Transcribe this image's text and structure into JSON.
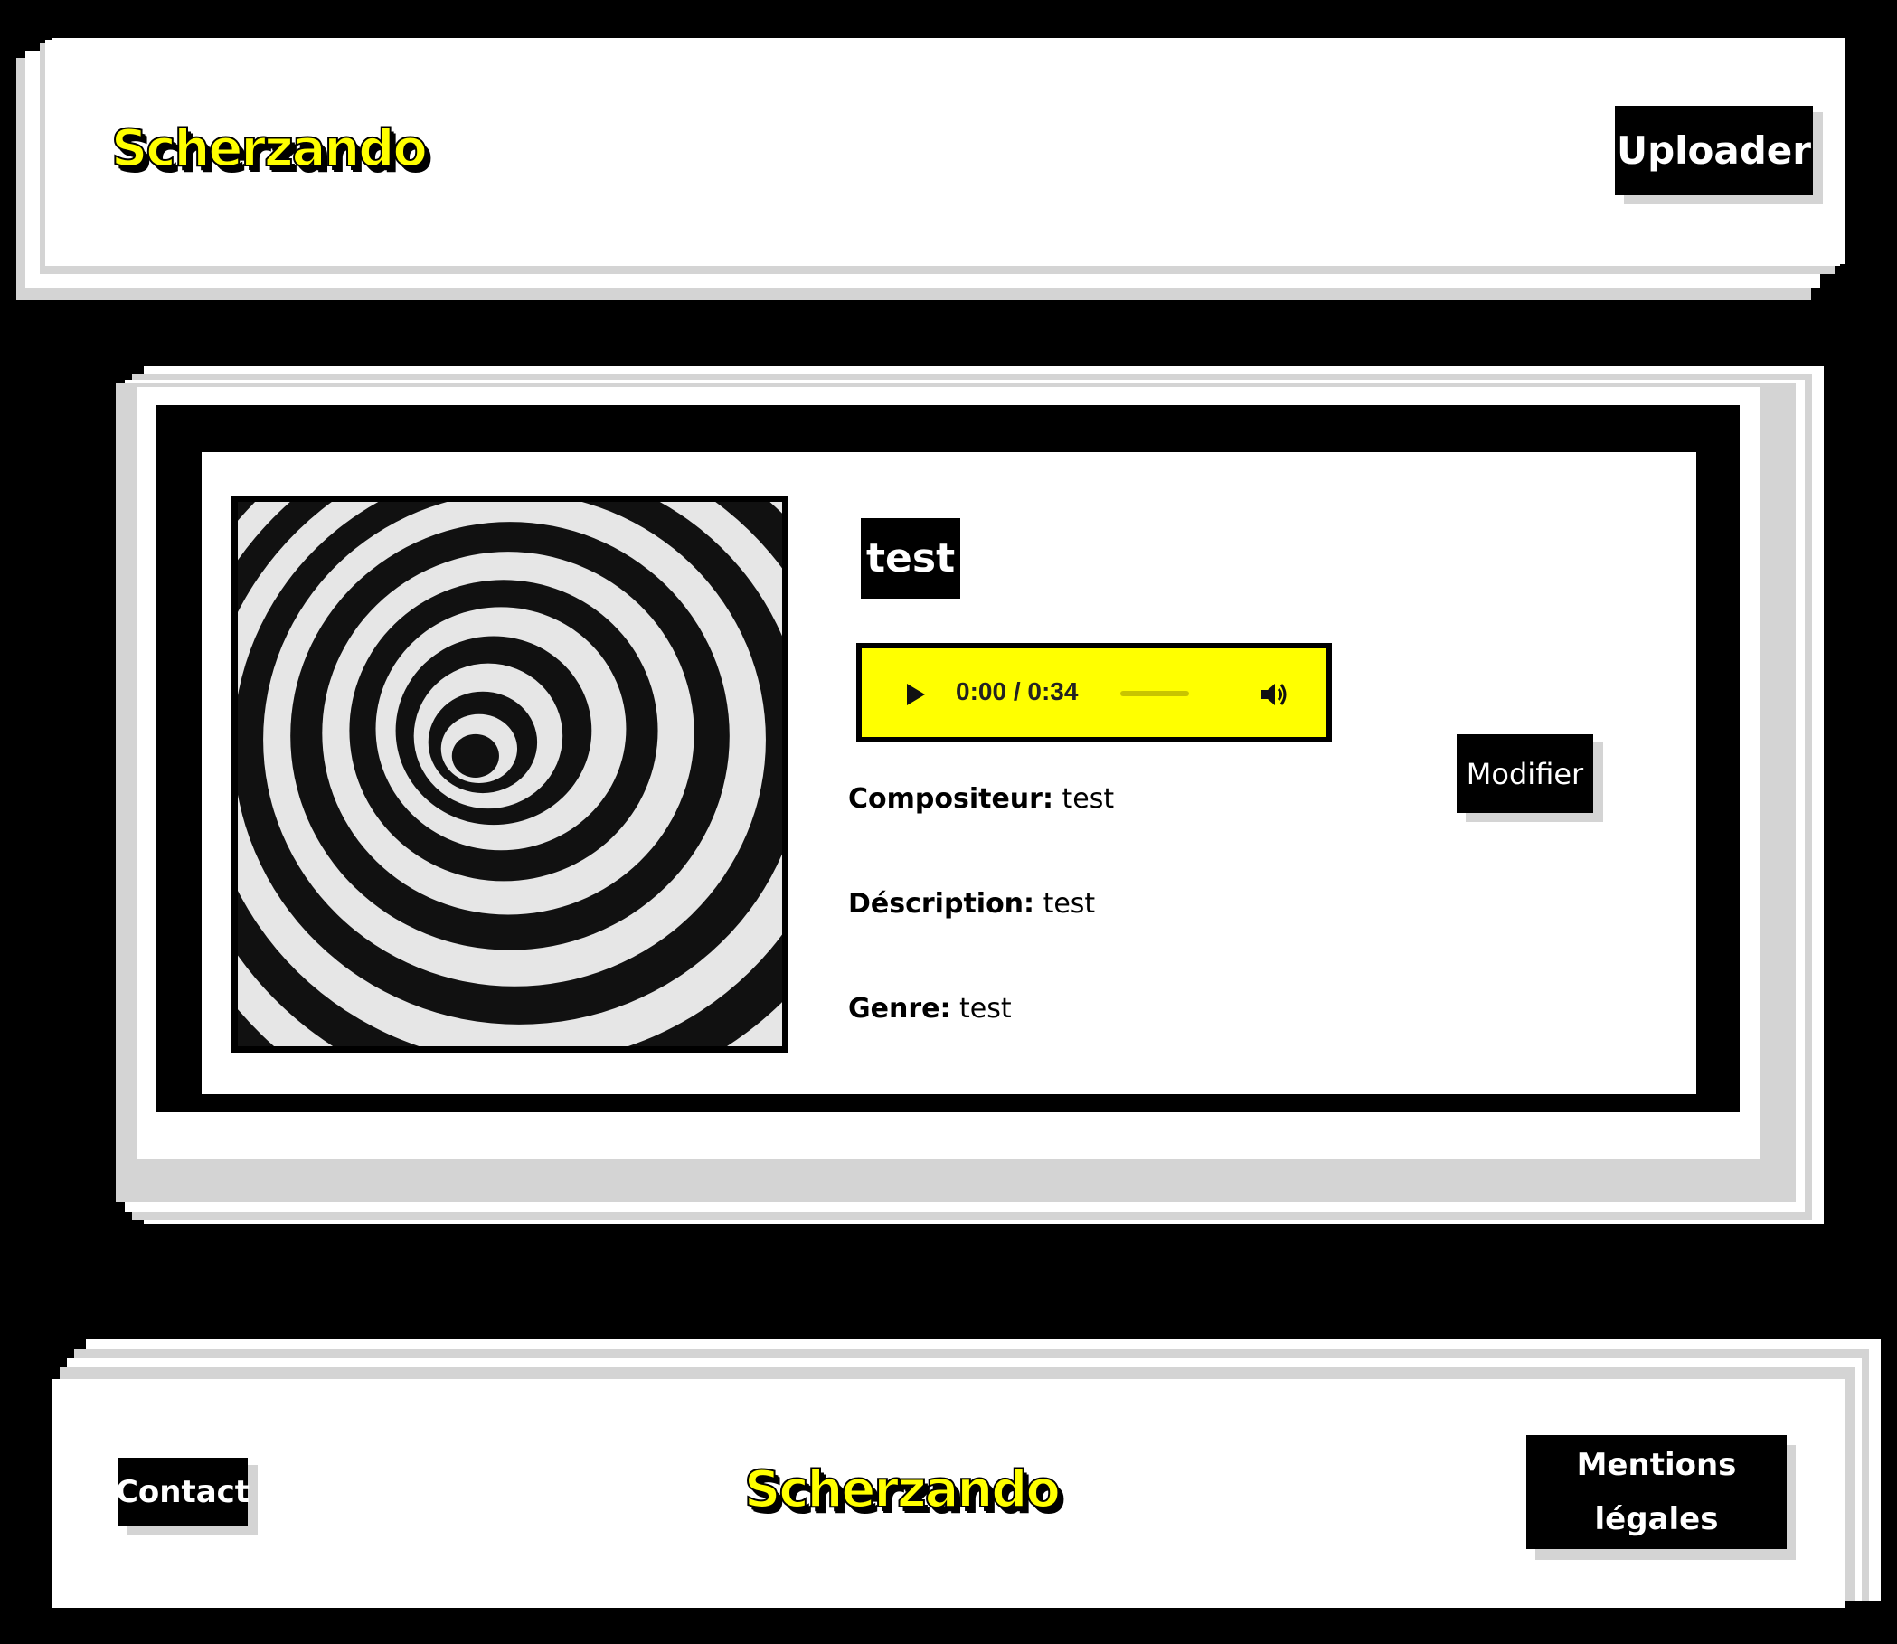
{
  "header": {
    "logo_text": "Scherzando",
    "upload_button_label": "Uploader"
  },
  "track": {
    "title": "test",
    "cover_image": "black-and-white-spiral",
    "player": {
      "time_display": "0:00 / 0:34",
      "progress": 0,
      "background_color": "#ffff00",
      "play_icon": "play-icon",
      "volume_icon": "volume-icon"
    },
    "edit_button_label": "Modifier",
    "fields": [
      {
        "label": "Compositeur:",
        "value": "test"
      },
      {
        "label": "Déscription:",
        "value": "test"
      },
      {
        "label": "Genre:",
        "value": "test"
      }
    ]
  },
  "footer": {
    "contact_label": "Contact",
    "logo_text": "Scherzando",
    "legal_label_line1": "Mentions",
    "legal_label_line2": "légales"
  },
  "colors": {
    "page_background": "#000000",
    "accent_yellow": "#ffff00",
    "shadow_grey": "#d4d4d4"
  }
}
